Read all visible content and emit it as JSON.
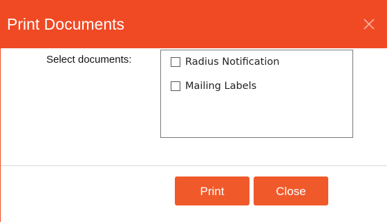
{
  "dialog": {
    "title": "Print Documents",
    "close_icon": "close-icon",
    "accent_color": "#f04a24"
  },
  "form": {
    "select_label": "Select documents:",
    "documents": [
      {
        "label": "Radius Notification",
        "checked": false
      },
      {
        "label": "Mailing Labels",
        "checked": false
      }
    ]
  },
  "footer": {
    "print_label": "Print",
    "close_label": "Close",
    "button_color": "#f05a2a"
  }
}
